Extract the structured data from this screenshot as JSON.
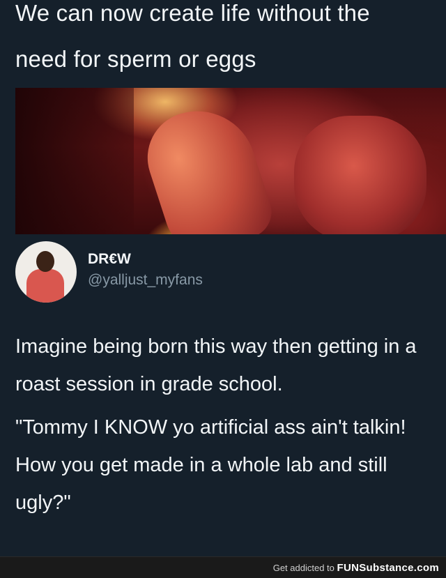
{
  "headline": {
    "line1": "We can now create life without the",
    "line2": "need for sperm or eggs"
  },
  "author": {
    "name": "DR€W",
    "handle": "@yalljust_myfans"
  },
  "tweet": {
    "para1": "Imagine being born this way then getting in a roast session in grade school.",
    "para2": "\"Tommy I KNOW yo artificial ass ain't talkin! How you get made in a whole lab and still ugly?\""
  },
  "footer": {
    "prefix": "Get addicted to",
    "brand": "FUNSubstance.com"
  },
  "colors": {
    "background": "#15202b",
    "handle": "#8899a6"
  }
}
